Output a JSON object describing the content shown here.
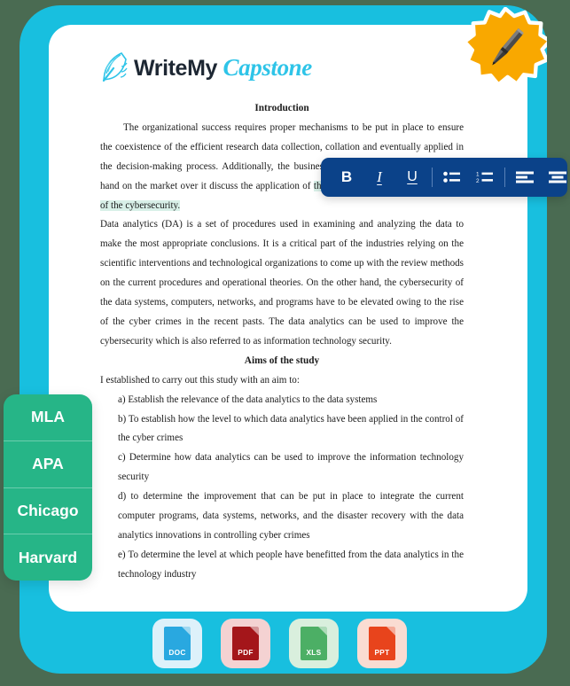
{
  "brand": {
    "name_write": "Write",
    "name_my": "My",
    "name_capstone": "Capstone",
    "quill_icon": "quill-pen-icon",
    "accent_color": "#2ec4e8"
  },
  "badge": {
    "icon": "pen-icon",
    "color": "#f9a800"
  },
  "frame": {
    "outer_color": "#18bfdf",
    "background_color": "#4a6b52"
  },
  "document": {
    "heading_1": "Introduction",
    "paragraph_1": "The organizational success requires proper mechanisms to be put in place to ensure the coexistence of the efficient research data collection, collation and eventually applied in the decision-making process. Additionally, the business or market while having a better hand on the market over it discuss the application of ",
    "paragraph_1_highlight": "the data analytics in the enhancement of the cybersecurity.",
    "paragraph_2": "Data analytics (DA) is a set of procedures used in examining and analyzing the data to make the most appropriate conclusions. It is a critical part of the industries relying on the scientific interventions and technological organizations to come up with the review methods on the current procedures and operational theories. On the other hand, the cybersecurity of the data systems, computers, networks, and programs have to be elevated owing to the rise of the cyber crimes in the recent pasts. The data analytics can be used to improve the cybersecurity which is also referred to as information technology security.",
    "heading_2": "Aims of the study",
    "paragraph_3": "I established to carry out this study with an aim to:",
    "aims": [
      "a) Establish the relevance of the data analytics to the data systems",
      "b) To establish how the level to which data analytics have been applied in the control of the cyber crimes",
      "c) Determine how data analytics can be used to improve the information technology security",
      "d) to determine the improvement that can be put in place to integrate the current computer programs, data systems, networks, and the disaster recovery with the data analytics innovations in controlling cyber crimes",
      "e) To determine the level at which people have benefitted from the data analytics in the technology industry"
    ],
    "highlight_color": "#d8f0e8"
  },
  "toolbar": {
    "background_color": "#0b4289",
    "buttons": [
      {
        "name": "bold-button",
        "label": "B",
        "icon": "bold-icon"
      },
      {
        "name": "italic-button",
        "label": "I",
        "icon": "italic-icon"
      },
      {
        "name": "underline-button",
        "label": "U",
        "icon": "underline-icon"
      },
      {
        "name": "bulleted-list-button",
        "label": "",
        "icon": "bulleted-list-icon"
      },
      {
        "name": "numbered-list-button",
        "label": "",
        "icon": "numbered-list-icon"
      },
      {
        "name": "align-left-button",
        "label": "",
        "icon": "align-left-icon"
      },
      {
        "name": "align-center-button",
        "label": "",
        "icon": "align-center-icon"
      },
      {
        "name": "align-right-button",
        "label": "",
        "icon": "align-right-icon"
      }
    ],
    "numbered_list_digits": [
      "1",
      "2"
    ]
  },
  "citation_styles": {
    "panel_color": "#26b587",
    "items": [
      {
        "label": "MLA"
      },
      {
        "label": "APA"
      },
      {
        "label": "Chicago"
      },
      {
        "label": "Harvard"
      }
    ]
  },
  "file_formats": [
    {
      "label": "DOC",
      "chip_color": "#ddf1fa",
      "page_color": "#29a8e0"
    },
    {
      "label": "PDF",
      "chip_color": "#f4d2d2",
      "page_color": "#a4161a"
    },
    {
      "label": "XLS",
      "chip_color": "#d9efdd",
      "page_color": "#4caf65"
    },
    {
      "label": "PPT",
      "chip_color": "#fadcd2",
      "page_color": "#e8441c"
    }
  ]
}
